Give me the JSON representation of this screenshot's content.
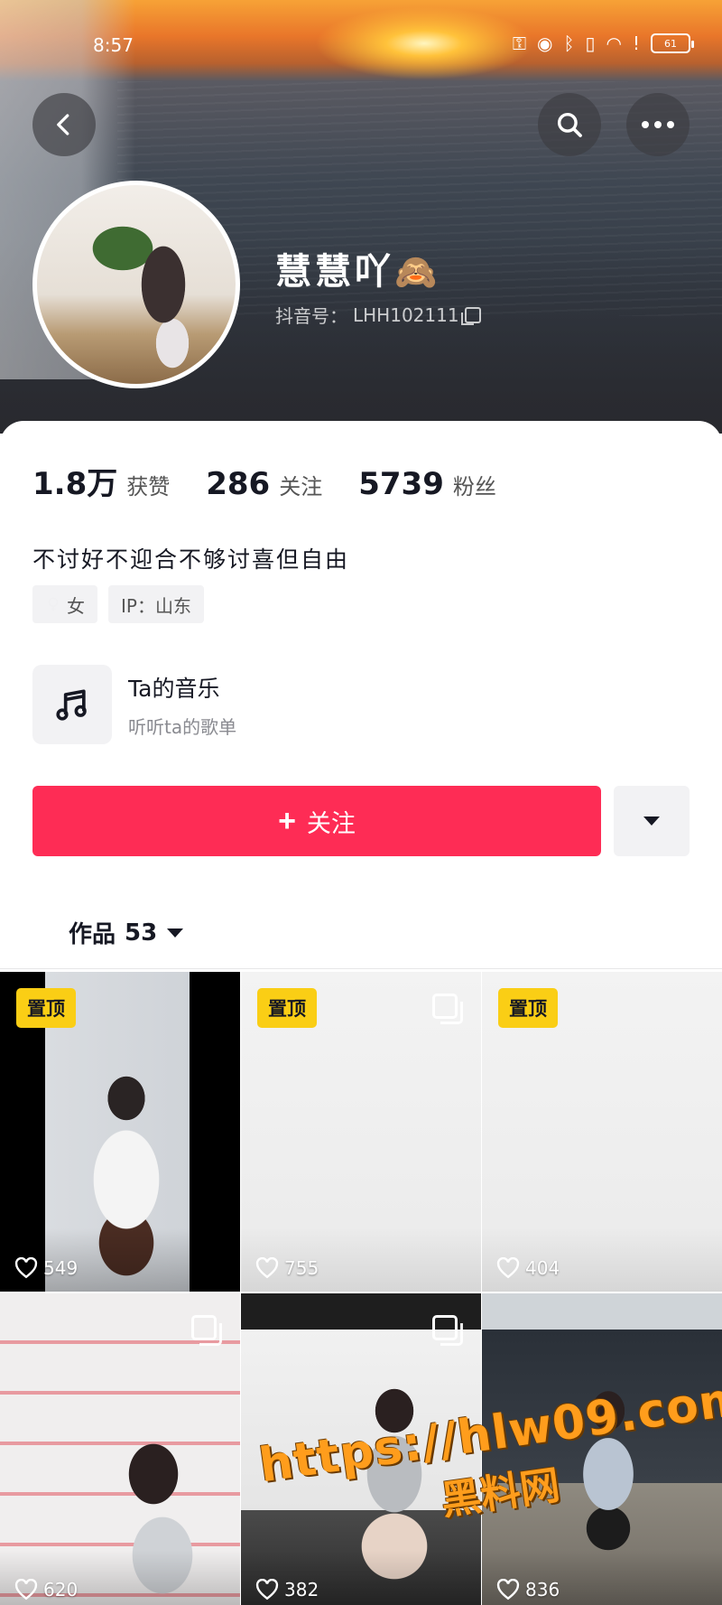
{
  "status_bar": {
    "time": "8:57",
    "battery": "61"
  },
  "header": {
    "back_icon": "chevron-left-icon",
    "search_icon": "search-icon",
    "more_icon": "more-horizontal-icon"
  },
  "profile": {
    "nickname": "慧慧吖",
    "nickname_emoji": "🙈",
    "id_label": "抖音号：",
    "id_value": "LHH102111"
  },
  "stats": [
    {
      "value": "1.8万",
      "label": "获赞"
    },
    {
      "value": "286",
      "label": "关注"
    },
    {
      "value": "5739",
      "label": "粉丝"
    }
  ],
  "bio": "不讨好不迎合不够讨喜但自由",
  "tags": {
    "gender": "女",
    "ip": "IP：山东"
  },
  "music": {
    "title": "Ta的音乐",
    "subtitle": "听听ta的歌单"
  },
  "actions": {
    "follow_label": "关注",
    "follow_plus": "+"
  },
  "works_tab": {
    "label": "作品",
    "count": "53"
  },
  "grid": [
    {
      "pinned": true,
      "pin_label": "置顶",
      "likes": "549",
      "multi": false
    },
    {
      "pinned": true,
      "pin_label": "置顶",
      "likes": "755",
      "multi": true
    },
    {
      "pinned": true,
      "pin_label": "置顶",
      "likes": "404",
      "multi": false
    },
    {
      "pinned": false,
      "likes": "620",
      "multi": true
    },
    {
      "pinned": false,
      "likes": "382",
      "multi": true
    },
    {
      "pinned": false,
      "likes": "836",
      "multi": false
    }
  ],
  "watermark": {
    "url": "https://hlw09.com",
    "name": "黑料网"
  },
  "colors": {
    "accent": "#fe2c55",
    "pin": "#face15"
  }
}
